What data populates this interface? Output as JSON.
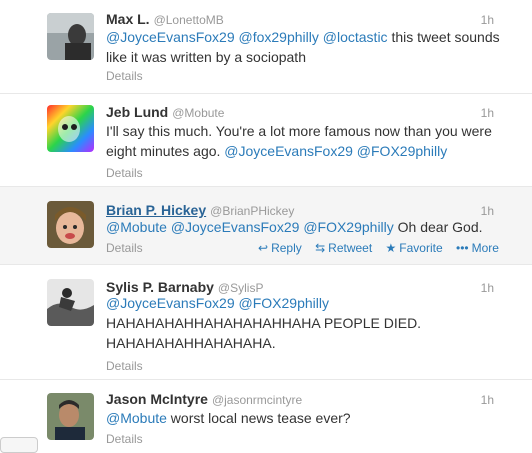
{
  "tweets": [
    {
      "name": "Max L.",
      "handle": "@LonettoMB",
      "time": "1h",
      "parts": [
        {
          "t": "@JoyceEvansFox29",
          "m": true
        },
        {
          "t": " ",
          "m": false
        },
        {
          "t": "@fox29philly",
          "m": true
        },
        {
          "t": " ",
          "m": false
        },
        {
          "t": "@loctastic",
          "m": true
        },
        {
          "t": " this tweet sounds like it was written by a sociopath",
          "m": false
        }
      ],
      "details": "Details"
    },
    {
      "name": "Jeb Lund",
      "handle": "@Mobute",
      "time": "1h",
      "parts": [
        {
          "t": "I'll say this much. You're a lot more famous now than you were eight minutes ago. ",
          "m": false
        },
        {
          "t": "@JoyceEvansFox29",
          "m": true
        },
        {
          "t": " ",
          "m": false
        },
        {
          "t": "@FOX29philly",
          "m": true
        }
      ],
      "details": "Details"
    },
    {
      "name": "Brian P. Hickey",
      "handle": "@BrianPHickey",
      "time": "1h",
      "parts": [
        {
          "t": "@Mobute",
          "m": true
        },
        {
          "t": " ",
          "m": false
        },
        {
          "t": "@JoyceEvansFox29",
          "m": true
        },
        {
          "t": " ",
          "m": false
        },
        {
          "t": "@FOX29philly",
          "m": true
        },
        {
          "t": " Oh dear God.",
          "m": false
        }
      ],
      "details": "Details",
      "actions": {
        "reply": "Reply",
        "retweet": "Retweet",
        "favorite": "Favorite",
        "more": "More"
      }
    },
    {
      "name": "Sylis P. Barnaby",
      "handle": "@SylisP",
      "time": "1h",
      "parts": [
        {
          "t": "@JoyceEvansFox29",
          "m": true
        },
        {
          "t": " ",
          "m": false
        },
        {
          "t": "@FOX29philly",
          "m": true
        },
        {
          "t": " HAHAHAHAHHAHAHAHAHHAHA PEOPLE DIED. HAHAHAHAHHAHAHAHA.",
          "m": false
        }
      ],
      "details": "Details"
    },
    {
      "name": "Jason McIntyre",
      "handle": "@jasonrmcintyre",
      "time": "1h",
      "parts": [
        {
          "t": "@Mobute",
          "m": true
        },
        {
          "t": " worst local news tease ever?",
          "m": false
        }
      ],
      "details": "Details"
    }
  ],
  "icons": {
    "reply": "reply-icon",
    "retweet": "retweet-icon",
    "favorite": "star-icon",
    "more": "more-dots-icon"
  },
  "colors": {
    "link": "#2b7bb9",
    "muted": "#999999",
    "text": "#333333",
    "hover_bg": "#f5f5f5"
  }
}
